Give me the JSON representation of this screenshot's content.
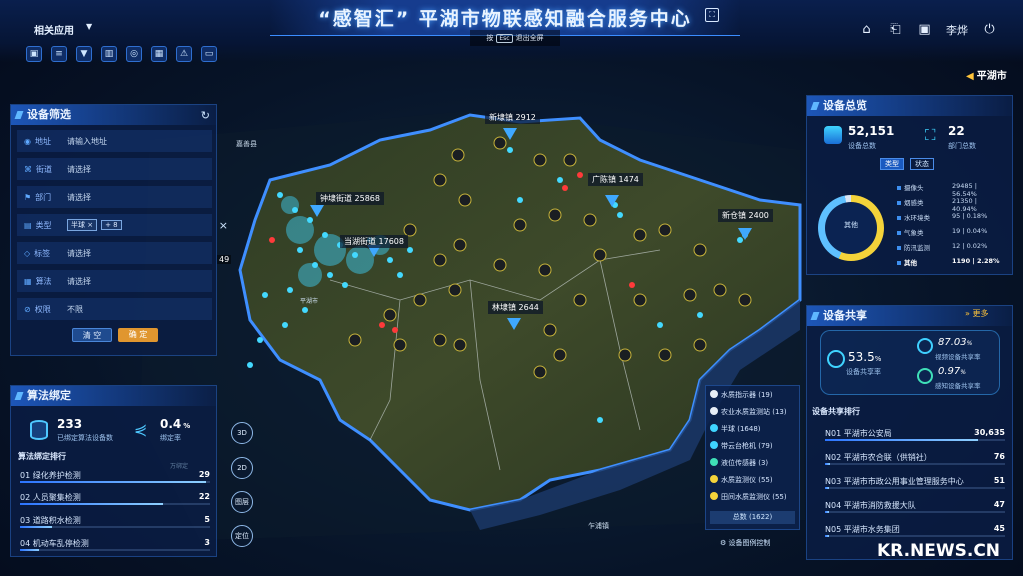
{
  "header": {
    "title": "“感智汇” 平湖市物联感知融合服务中心",
    "esc_prefix": "按",
    "esc_key": "Esc",
    "esc_suffix": "退出全屏",
    "app_menu": "相关应用",
    "user": "李烨",
    "region": "平湖市"
  },
  "filter_panel": {
    "title": "设备筛选",
    "rows": [
      {
        "label": "地址",
        "value": "请输入地址",
        "icon": "location-icon"
      },
      {
        "label": "街道",
        "value": "请选择",
        "icon": "street-icon"
      },
      {
        "label": "部门",
        "value": "请选择",
        "icon": "department-icon"
      },
      {
        "label": "类型",
        "value": "",
        "icon": "type-icon"
      },
      {
        "label": "标签",
        "value": "请选择",
        "icon": "tag-icon"
      },
      {
        "label": "算法",
        "value": "请选择",
        "icon": "algorithm-icon"
      },
      {
        "label": "权限",
        "value": "不限",
        "icon": "permission-icon"
      }
    ],
    "type_chip": "半球 ×",
    "type_more": "+ 8",
    "clear_label": "清 空",
    "confirm_label": "确 定"
  },
  "algo_panel": {
    "title": "算法绑定",
    "bound_value": "233",
    "bound_label": "已绑定算法设备数",
    "rate_value": "0.4",
    "rate_unit": "%",
    "rate_label": "绑定率",
    "ranking_title": "算法绑定排行",
    "ranking_hint": "万绑定",
    "rankings": [
      {
        "label": "01 绿化养护检测",
        "value": "29",
        "fraction": 0.98
      },
      {
        "label": "02 人员聚集检测",
        "value": "22",
        "fraction": 0.75
      },
      {
        "label": "03 道路积水检测",
        "value": "5",
        "fraction": 0.17
      },
      {
        "label": "04 机动车乱停检测",
        "value": "3",
        "fraction": 0.1
      }
    ]
  },
  "overview_panel": {
    "title": "设备总览",
    "total_devices": "52,151",
    "total_label": "设备总数",
    "dept_total": "22",
    "dept_label": "部门总数",
    "tab_type": "类型",
    "tab_status": "状态",
    "ring_center": "其他",
    "items": [
      {
        "name": "摄像头",
        "value": "29485 | 56.54%"
      },
      {
        "name": "烟感类",
        "value": "21350 | 40.94%"
      },
      {
        "name": "水环境类",
        "value": "95 | 0.18%"
      },
      {
        "name": "气象类",
        "value": "19 | 0.04%"
      },
      {
        "name": "防汛监测",
        "value": "12 | 0.02%"
      },
      {
        "name": "其他",
        "value": "1190 | 2.28%"
      }
    ]
  },
  "share_panel": {
    "title": "设备共享",
    "more_label": "更多",
    "device_share_rate": "53.5",
    "device_share_label": "设备共享率",
    "video_share_rate": "87.03",
    "video_share_label": "视频设备共享率",
    "sensor_share_rate": "0.97",
    "sensor_share_label": "感知设备共享率",
    "pct": "%",
    "ranking_title": "设备共享排行",
    "rankings": [
      {
        "label": "N01 平湖市公安局",
        "value": "30,635",
        "fraction": 1.0
      },
      {
        "label": "N02 平湖市农合联（供销社）",
        "value": "76",
        "fraction": 0.02
      },
      {
        "label": "N03 平湖市市政公用事业管理服务中心",
        "value": "51",
        "fraction": 0.02
      },
      {
        "label": "N04 平湖市消防救援大队",
        "value": "47",
        "fraction": 0.015
      },
      {
        "label": "N05 平湖市水务集团",
        "value": "45",
        "fraction": 0.015
      }
    ]
  },
  "legend": {
    "items": [
      {
        "label": "水质指示器 (19)",
        "color": "#e7eef7"
      },
      {
        "label": "农业水质监测站 (13)",
        "color": "#e7eef7"
      },
      {
        "label": "半球 (1648)",
        "color": "#3fd4ff"
      },
      {
        "label": "带云台枪机 (79)",
        "color": "#3fd4ff"
      },
      {
        "label": "液位传感器 (3)",
        "color": "#3fe0b8"
      },
      {
        "label": "水质监测仪 (55)",
        "color": "#f4d33a"
      },
      {
        "label": "田间水质监测仪 (55)",
        "color": "#f4d33a"
      }
    ],
    "total": "总数 (1622)",
    "control_label": "设备图例控制"
  },
  "map": {
    "callouts": [
      {
        "label": "新埭镇 2912"
      },
      {
        "label": "钟埭街道 25868"
      },
      {
        "label": "广陈镇 1474"
      },
      {
        "label": "当湖街道 17608"
      },
      {
        "label": "新仓镇 2400"
      },
      {
        "label": "林埭镇 2644"
      }
    ],
    "place_labels": [
      "嘉善县",
      "平湖市",
      "乍浦镇",
      "49"
    ],
    "side_buttons": [
      "3D",
      "2D",
      "图层",
      "定位"
    ]
  },
  "watermark": "KR.NEWS.CN"
}
